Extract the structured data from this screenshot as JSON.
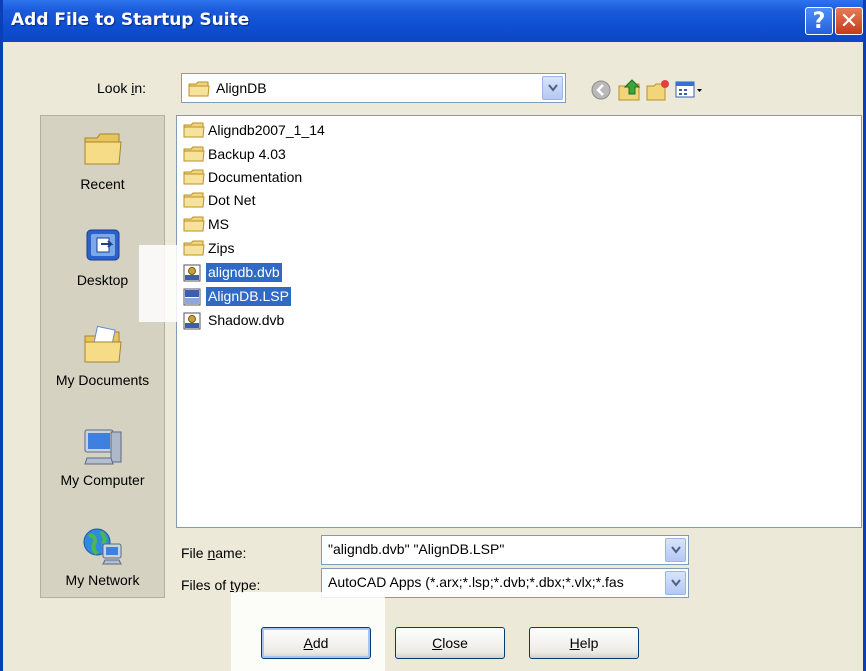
{
  "window": {
    "title": "Add File to Startup Suite"
  },
  "lookin": {
    "label_pre": "Look ",
    "label_key": "i",
    "label_post": "n:",
    "value": "AlignDB"
  },
  "places": [
    {
      "label": "Recent",
      "icon": "recent-folder-icon"
    },
    {
      "label": "Desktop",
      "icon": "desktop-icon"
    },
    {
      "label": "My Documents",
      "icon": "my-documents-icon"
    },
    {
      "label": "My Computer",
      "icon": "my-computer-icon"
    },
    {
      "label": "My Network",
      "icon": "my-network-icon"
    }
  ],
  "files": [
    {
      "name": "Aligndb2007_1_14",
      "type": "folder",
      "selected": false
    },
    {
      "name": "Backup 4.03",
      "type": "folder",
      "selected": false
    },
    {
      "name": "Documentation",
      "type": "folder",
      "selected": false
    },
    {
      "name": "Dot Net",
      "type": "folder",
      "selected": false
    },
    {
      "name": "MS",
      "type": "folder",
      "selected": false
    },
    {
      "name": "Zips",
      "type": "folder",
      "selected": false
    },
    {
      "name": "aligndb.dvb",
      "type": "dvb",
      "selected": true
    },
    {
      "name": "AlignDB.LSP",
      "type": "lsp",
      "selected": true
    },
    {
      "name": "Shadow.dvb",
      "type": "dvb",
      "selected": false
    }
  ],
  "filename": {
    "label_pre": "File ",
    "label_key": "n",
    "label_post": "ame:",
    "value": "\"aligndb.dvb\" \"AlignDB.LSP\""
  },
  "filetype": {
    "label_pre": "Files of ",
    "label_key": "t",
    "label_post": "ype:",
    "value": "AutoCAD Apps (*.arx;*.lsp;*.dvb;*.dbx;*.vlx;*.fas"
  },
  "buttons": {
    "add": {
      "key": "A",
      "rest": "dd"
    },
    "close": {
      "key": "C",
      "rest": "lose"
    },
    "help": {
      "key": "H",
      "rest": "elp"
    }
  },
  "colors": {
    "titlebar": "#0F4FD2",
    "selection": "#316AC5",
    "dialog": "#ECE9D8"
  }
}
